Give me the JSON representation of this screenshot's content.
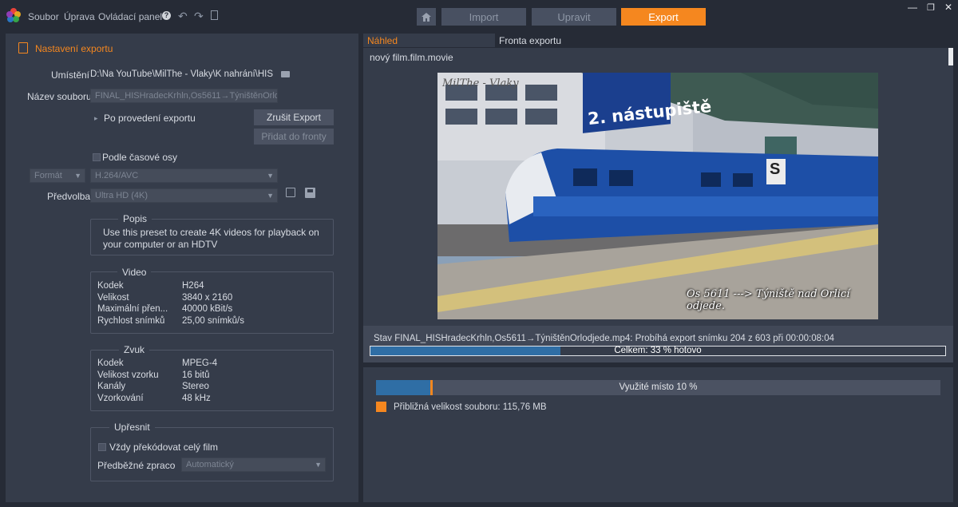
{
  "menu": {
    "file": "Soubor",
    "edit": "Úprava",
    "control_panel": "Ovládací panel"
  },
  "toolbar": {
    "import": "Import",
    "edit": "Upravit",
    "export": "Export"
  },
  "left": {
    "section_title": "Nastavení exportu",
    "location_label": "Umístění",
    "location_value": "D:\\Na YouTube\\MilThe - Vlaky\\K nahrání\\HIS...",
    "filename_label": "Název souboru",
    "filename_value": "FINAL_HISHradecKrhln,Os5611→TýništěnOrloc",
    "after_export_label": "Po provedení exportu",
    "cancel_export": "Zrušit Export",
    "add_to_queue": "Přidat do fronty",
    "timeline_label": "Podle časové osy",
    "format_label": "Formát",
    "format_value": "H.264/AVC",
    "preset_label": "Předvolba",
    "preset_value": "Ultra HD (4K)",
    "description": {
      "title": "Popis",
      "text": "Use this preset to create 4K videos for playback on your computer or an HDTV"
    },
    "video": {
      "title": "Video",
      "rows": [
        {
          "k": "Kodek",
          "v": "H264"
        },
        {
          "k": "Velikost",
          "v": "3840 x 2160"
        },
        {
          "k": "Maximální přen...",
          "v": "40000 kBit/s"
        },
        {
          "k": "Rychlost snímků",
          "v": "25,00 snímků/s"
        }
      ]
    },
    "audio": {
      "title": "Zvuk",
      "rows": [
        {
          "k": "Kodek",
          "v": "MPEG-4"
        },
        {
          "k": "Velikost vzorku",
          "v": "16 bitů"
        },
        {
          "k": "Kanály",
          "v": "Stereo"
        },
        {
          "k": "Vzorkování",
          "v": "48 kHz"
        }
      ]
    },
    "refine": {
      "title": "Upřesnit",
      "always_label": "Vždy překódovat celý film",
      "prerender_label": "Předběžné zpraco",
      "prerender_value": "Automatický"
    }
  },
  "right": {
    "tab_preview": "Náhled",
    "tab_queue": "Fronta exportu",
    "project_name": "nový film.film.movie",
    "watermark": "MilThe - Vlaky",
    "sign_text": "2. nástupiště",
    "sign_letter": "S",
    "overlay_caption": "Os 5611 ---> Týniště nad Orlicí odjede.",
    "status": "Stav FINAL_HISHradecKrhln,Os5611→TýništěnOrlodjede.mp4: Probíhá export snímku 204 z 603 při 00:00:08:04",
    "overall_label": "Celkem: 33 % hotovo",
    "overall_progress": 0.33,
    "space_label": "Využité místo 10 %",
    "space_used": 0.1,
    "file_size_label": "Přibližná velikost souboru: 115,76 MB"
  },
  "colors": {
    "accent": "#f5871f",
    "panel": "#353c4a",
    "progress": "#2f6ea5"
  }
}
